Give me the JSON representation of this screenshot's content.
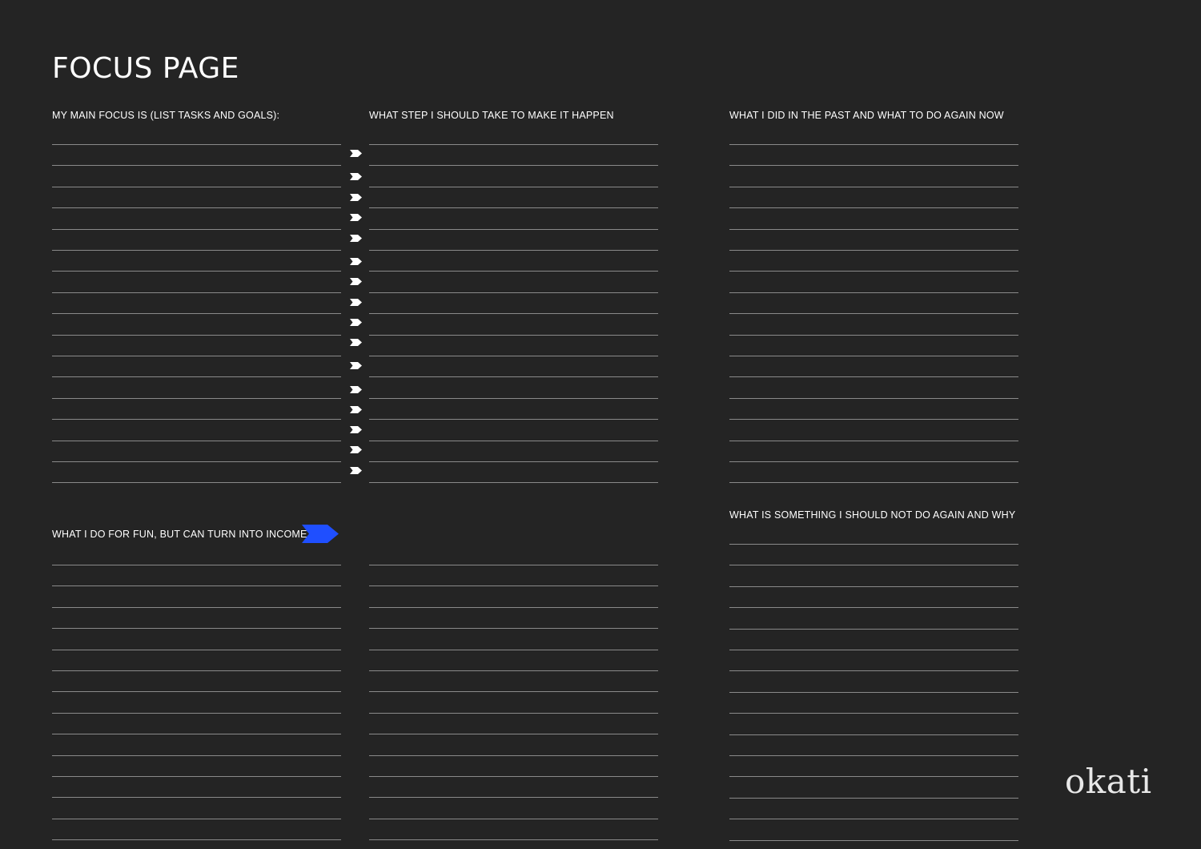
{
  "page": {
    "title": "FOCUS PAGE"
  },
  "sections": {
    "main_focus": {
      "heading": "MY MAIN FOCUS IS (LIST TASKS AND GOALS):"
    },
    "next_steps": {
      "heading": "WHAT STEP I SHOULD TAKE TO MAKE IT HAPPEN"
    },
    "past_actions": {
      "heading": "WHAT I DID IN THE PAST AND WHAT TO DO AGAIN NOW"
    },
    "fun_income": {
      "heading": "WHAT I DO FOR FUN, BUT CAN TURN INTO INCOME"
    },
    "avoid": {
      "heading": "WHAT IS SOMETHING I SHOULD NOT DO AGAIN AND WHY"
    }
  },
  "brand": {
    "logo_text": "okati"
  },
  "colors": {
    "background": "#242424",
    "text": "#ffffff",
    "rule": "#8a8a8a",
    "accent_arrow": "#1f4fff"
  },
  "icons": {
    "row_arrow": "chevron-right-icon",
    "heading_arrow": "arrow-right-icon"
  }
}
